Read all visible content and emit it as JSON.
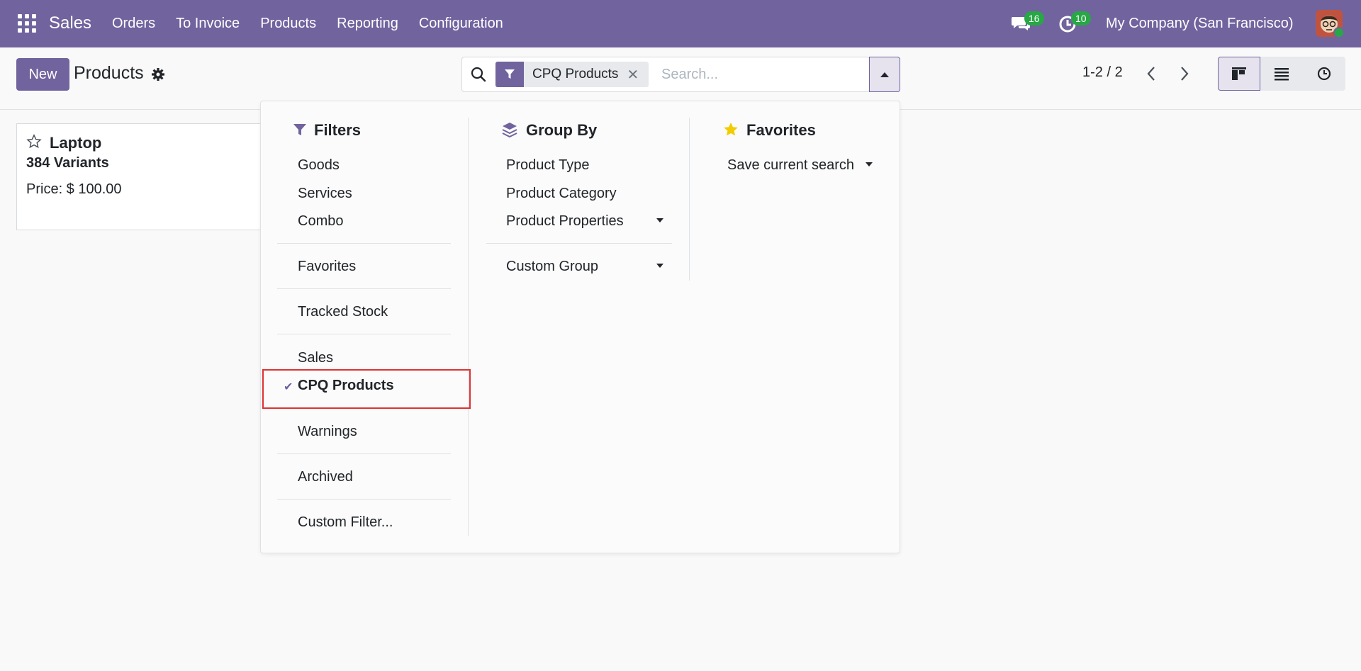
{
  "navbar": {
    "brand": "Sales",
    "menu": [
      "Orders",
      "To Invoice",
      "Products",
      "Reporting",
      "Configuration"
    ],
    "messages_count": "16",
    "activities_count": "10",
    "company": "My Company (San Francisco)"
  },
  "control_panel": {
    "new_button": "New",
    "title": "Products",
    "search": {
      "facet": "CPQ Products",
      "placeholder": "Search..."
    },
    "pager": "1-2 / 2"
  },
  "card": {
    "name": "Laptop",
    "variants": "384 Variants",
    "price": "Price: $ 100.00"
  },
  "dropdown": {
    "filters_title": "Filters",
    "filters": [
      "Goods",
      "Services",
      "Combo",
      "Favorites",
      "Tracked Stock",
      "Sales",
      "CPQ Products",
      "Warnings",
      "Archived",
      "Custom Filter..."
    ],
    "active_filter": "CPQ Products",
    "groupby_title": "Group By",
    "groupby": [
      "Product Type",
      "Product Category",
      "Product Properties",
      "Custom Group"
    ],
    "favorites_title": "Favorites",
    "favorites": [
      "Save current search"
    ]
  },
  "colors": {
    "brand": "#71639e",
    "badge": "#28a745",
    "highlight": "#e03131",
    "star": "#f3cc00"
  }
}
